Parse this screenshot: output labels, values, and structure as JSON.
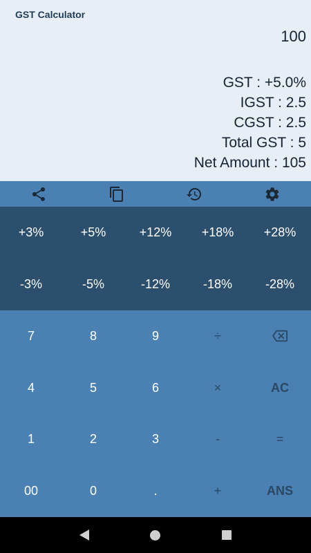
{
  "app": {
    "title": "GST Calculator"
  },
  "display": {
    "input": "100",
    "gst": "GST : +5.0%",
    "igst": "IGST : 2.5",
    "cgst": "CGST : 2.5",
    "total_gst": "Total GST : 5",
    "net_amount": "Net Amount : 105"
  },
  "toolbar": {
    "icons": [
      "share-icon",
      "copy-icon",
      "history-icon",
      "settings-icon"
    ]
  },
  "percent_keys": {
    "add": [
      "+3%",
      "+5%",
      "+12%",
      "+18%",
      "+28%"
    ],
    "sub": [
      "-3%",
      "-5%",
      "-12%",
      "-18%",
      "-28%"
    ]
  },
  "keypad": {
    "rows": [
      [
        "7",
        "8",
        "9",
        "÷",
        ""
      ],
      [
        "4",
        "5",
        "6",
        "×",
        "AC"
      ],
      [
        "1",
        "2",
        "3",
        "-",
        "="
      ],
      [
        "00",
        "0",
        ".",
        "+",
        "ANS"
      ]
    ],
    "backspace_icon": "backspace-icon"
  },
  "colors": {
    "display_bg": "#e8eef6",
    "keypad_bg": "#4a81b2",
    "percent_bg": "#2c4f6e",
    "operator_text": "#2a4763"
  }
}
